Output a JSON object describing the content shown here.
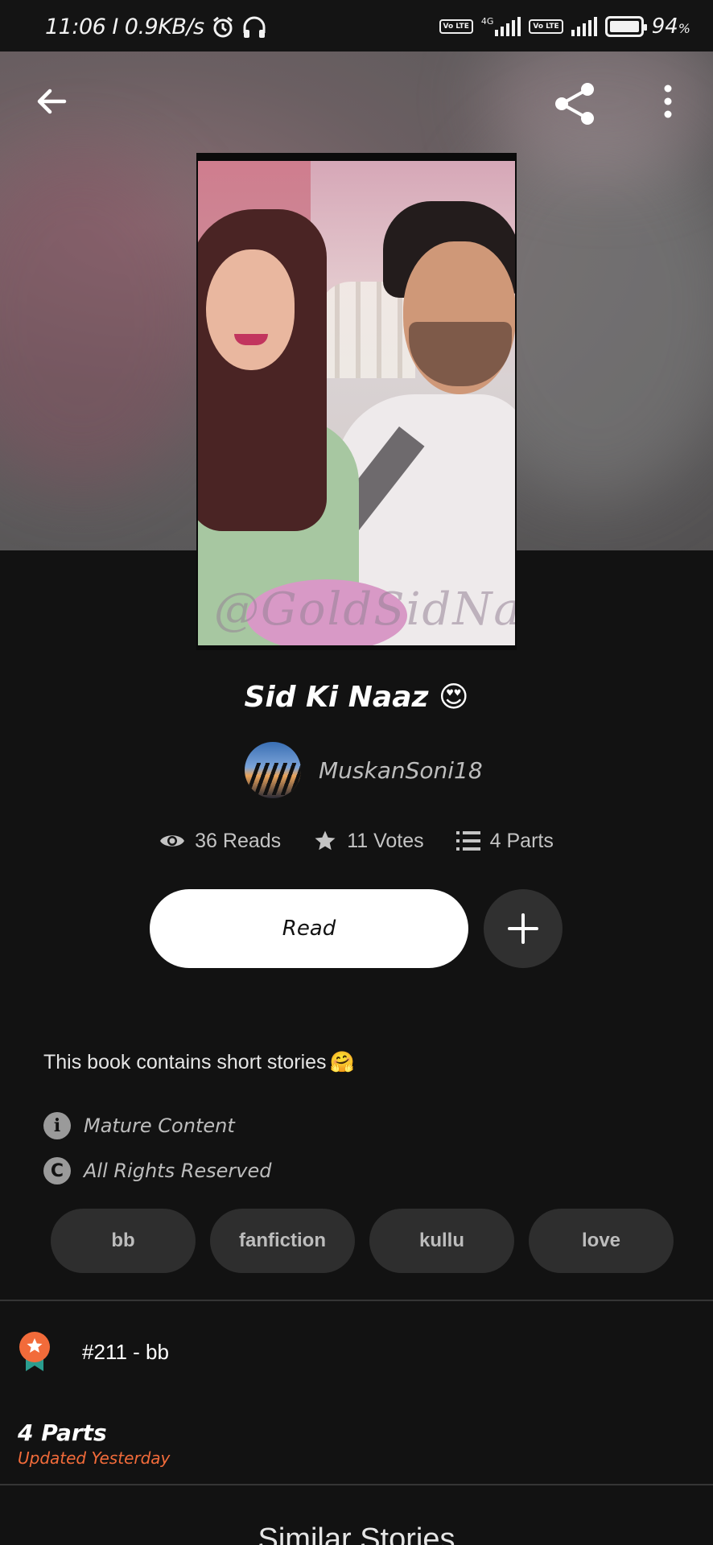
{
  "status_bar": {
    "time": "11:06",
    "speed": "0.9KB/s",
    "network_label": "4G",
    "volte_label": "Vo LTE",
    "battery": "94",
    "battery_unit": "%"
  },
  "story": {
    "title": "Sid Ki Naaz",
    "title_emoji": "😍",
    "cover_watermark": "@GoldSidNaaz",
    "author": "MuskanSoni18",
    "reads": "36 Reads",
    "votes": "11 Votes",
    "parts": "4 Parts",
    "description": "This book contains short stories",
    "description_emoji": "🤗",
    "mature_label": "Mature Content",
    "rights_label": "All Rights Reserved"
  },
  "actions": {
    "read_label": "Read"
  },
  "tags": [
    "bb",
    "fanfiction",
    "kullu",
    "love"
  ],
  "ranking": {
    "label": "#211 - bb"
  },
  "toc": {
    "parts_title": "4 Parts",
    "updated": "Updated Yesterday"
  },
  "similar": {
    "heading": "Similar Stories"
  },
  "colors": {
    "background": "#121212",
    "accent_orange": "#f26b3a",
    "tag_bg": "#2e2e2e",
    "button_white": "#ffffff"
  },
  "icons": {
    "back": "arrow-left-icon",
    "share": "share-icon",
    "more": "more-vertical-icon",
    "reads": "eye-icon",
    "votes": "star-icon",
    "parts": "list-icon",
    "add": "plus-icon",
    "mature": "info-icon",
    "rights": "copyright-icon",
    "rank": "award-badge-icon",
    "alarm": "alarm-icon",
    "headphones": "headphones-icon"
  }
}
